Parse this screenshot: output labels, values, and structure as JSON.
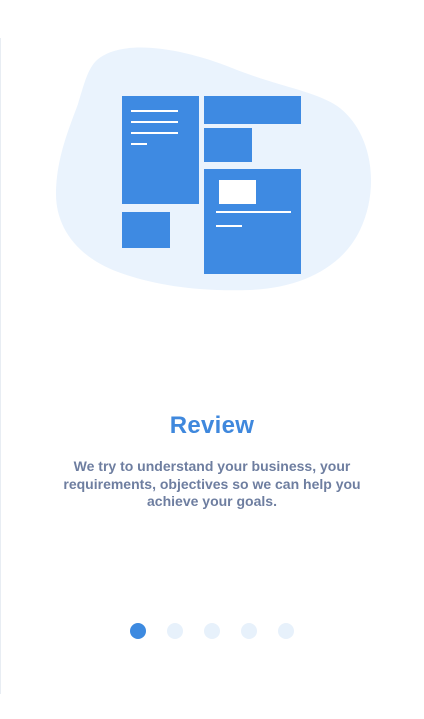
{
  "slide": {
    "title": "Review",
    "description": "We try to understand your business, your requirements, objectives so we can help you achieve your goals."
  },
  "illustration": {
    "icon": "review-documents-illustration",
    "blob_color": "#eaf3fd",
    "panel_color": "#3e8ae2",
    "line_color": "#ffffff"
  },
  "pagination": {
    "total": 5,
    "current": 1,
    "active_color": "#3d8ae0",
    "inactive_color": "#e7f1fb"
  },
  "colors": {
    "title": "#3f88dd",
    "description": "#6e7ea0",
    "background": "#ffffff"
  }
}
